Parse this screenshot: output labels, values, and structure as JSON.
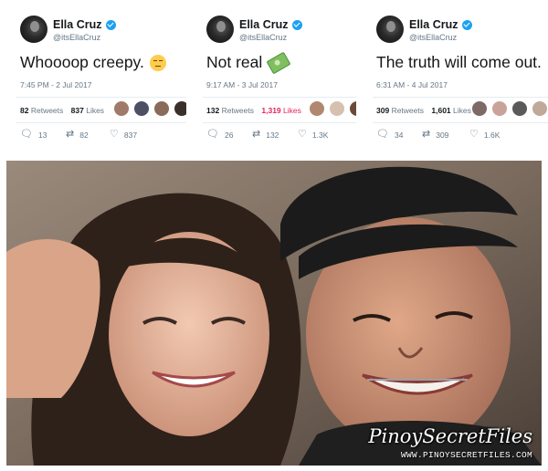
{
  "tweets": [
    {
      "name": "Ella Cruz",
      "handle": "@itsEllaCruz",
      "text": "Whoooop creepy.",
      "emoji": "unamused-face",
      "timestamp": "7:45 PM - 2 Jul 2017",
      "retweets": "82",
      "retweets_label": "Retweets",
      "likes": "837",
      "likes_label": "Likes",
      "likes_color": "#14171a",
      "liker_colors": [
        "#a07a68",
        "#4d4f63",
        "#8a6a58",
        "#3a2f2b",
        "#c49a86"
      ],
      "replies_count": "13",
      "retweet_count": "82",
      "like_count": "837"
    },
    {
      "name": "Ella Cruz",
      "handle": "@itsEllaCruz",
      "text": "Not real",
      "emoji": "money-with-wings",
      "timestamp": "9:17 AM - 3 Jul 2017",
      "retweets": "132",
      "retweets_label": "Retweets",
      "likes": "1,319",
      "likes_label": "Likes",
      "likes_color": "#e0245e",
      "liker_colors": [
        "#b08870",
        "#d8c0b0",
        "#6b4a3a",
        "#9a7462"
      ],
      "replies_count": "26",
      "retweet_count": "132",
      "like_count": "1.3K"
    },
    {
      "name": "Ella Cruz",
      "handle": "@itsEllaCruz",
      "text": "The truth will come out.",
      "emoji": "",
      "timestamp": "6:31 AM - 4 Jul 2017",
      "retweets": "309",
      "retweets_label": "Retweets",
      "likes": "1,601",
      "likes_label": "Likes",
      "likes_color": "#14171a",
      "liker_colors": [
        "#7d6a66",
        "#c9a39a",
        "#5a5a5a",
        "#bfa99a",
        "#d6c4b5"
      ],
      "replies_count": "34",
      "retweet_count": "309",
      "like_count": "1.6K"
    }
  ],
  "icons": {
    "reply": "reply-icon",
    "retweet": "retweet-icon",
    "like": "heart-icon",
    "verified": "verified-badge-icon"
  },
  "photo": {
    "watermark_brand": "PinoySecretFiles",
    "watermark_url": "WWW.PINOYSECRETFILES.COM"
  },
  "colors": {
    "verified_blue": "#1da1f2",
    "likes_pink": "#e0245e",
    "muted_text": "#657786",
    "primary_text": "#14171a"
  }
}
